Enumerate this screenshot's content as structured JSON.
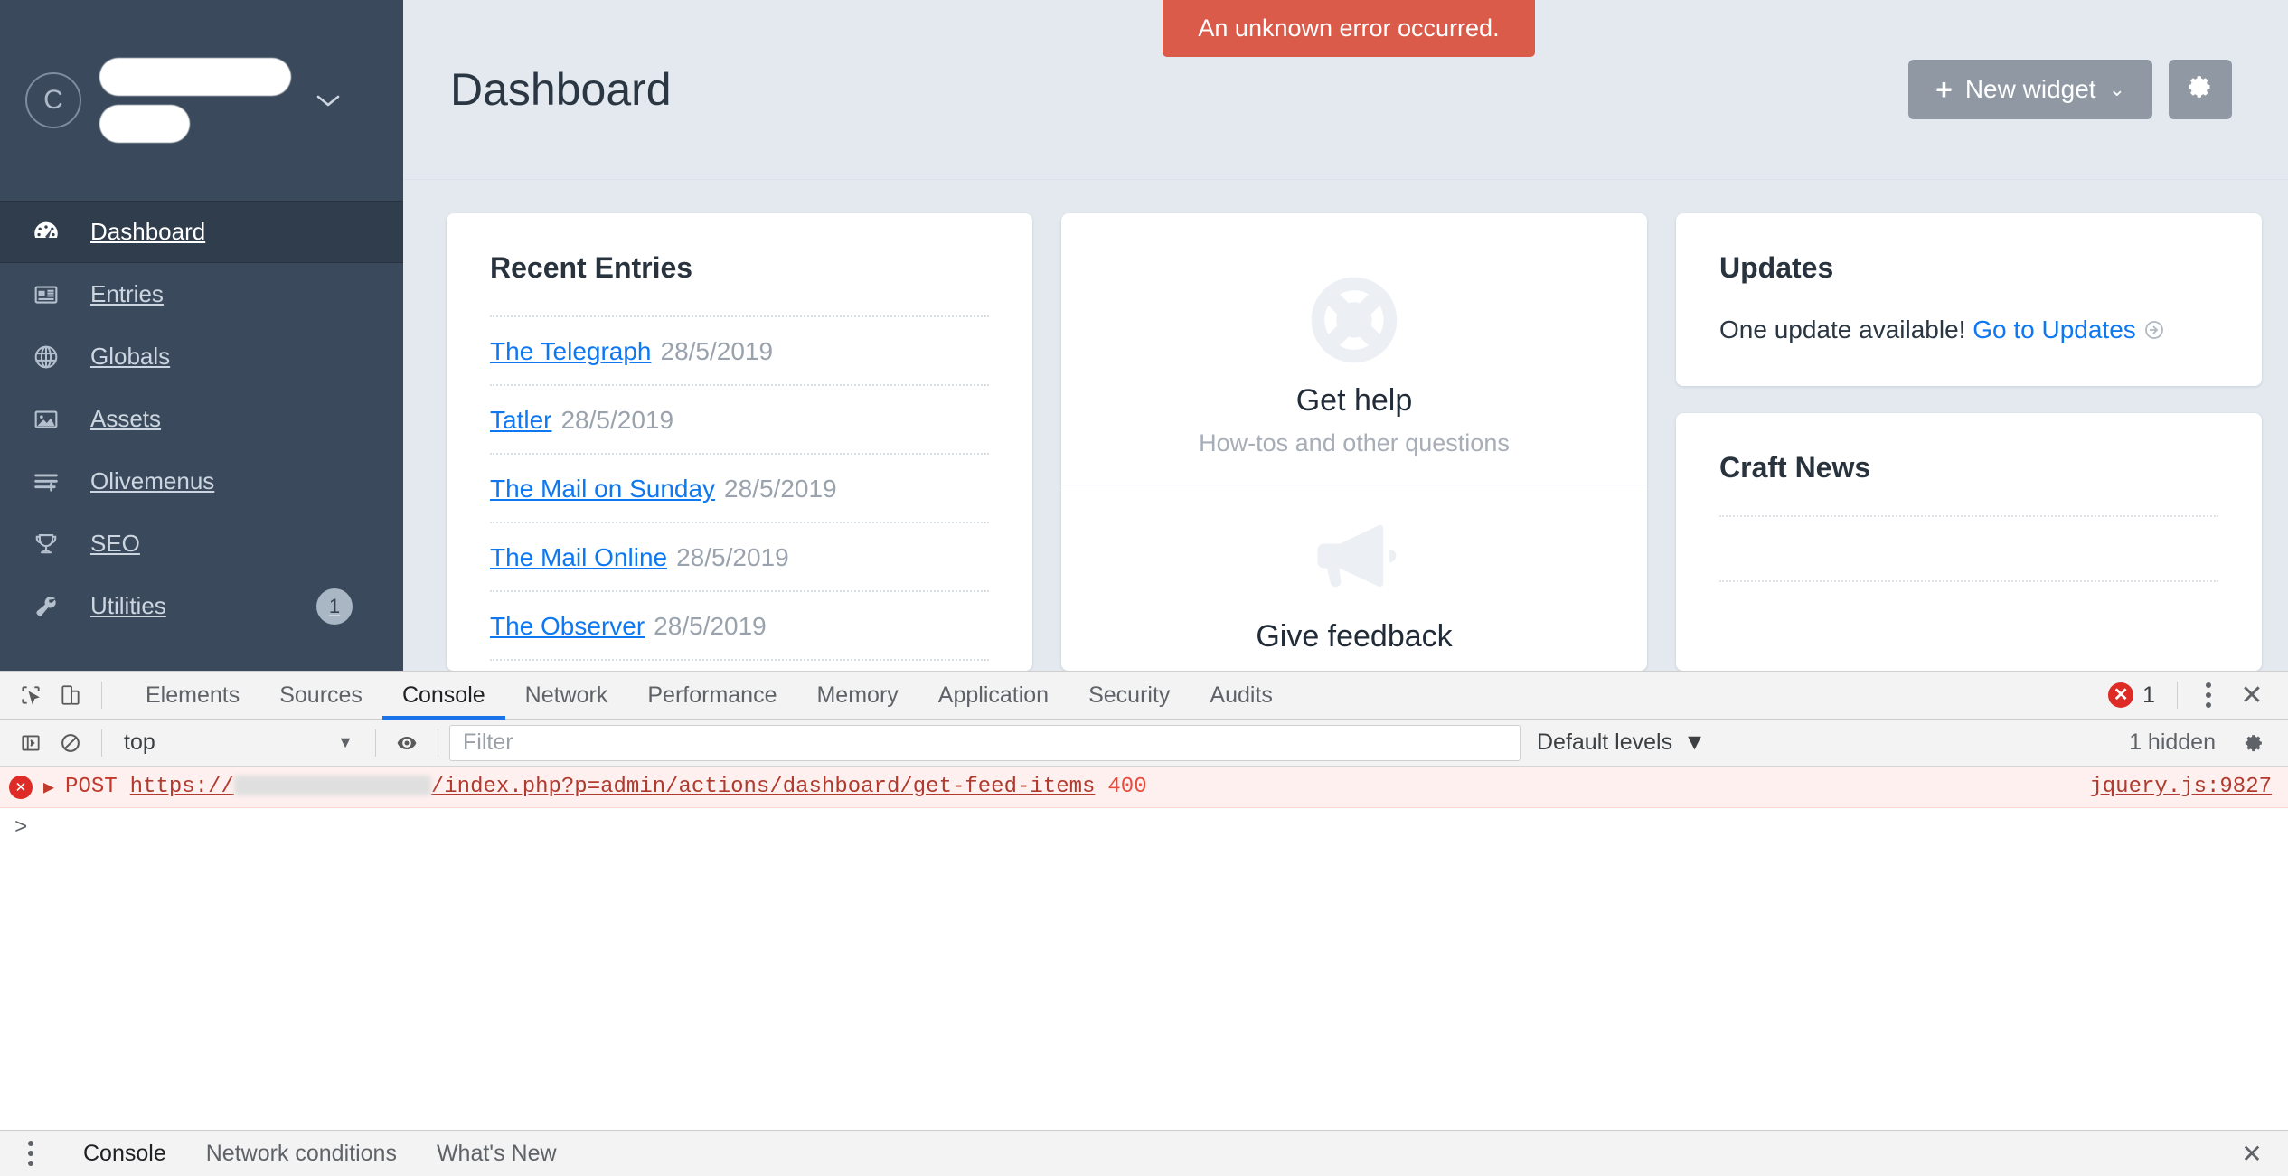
{
  "app": {
    "sidebar": {
      "logo_letter": "C",
      "site_name_redacted": true,
      "items": [
        {
          "label": "Dashboard",
          "icon": "gauge-icon",
          "active": true,
          "badge": ""
        },
        {
          "label": "Entries",
          "icon": "newspaper-icon",
          "active": false,
          "badge": ""
        },
        {
          "label": "Globals",
          "icon": "globe-icon",
          "active": false,
          "badge": ""
        },
        {
          "label": "Assets",
          "icon": "image-icon",
          "active": false,
          "badge": ""
        },
        {
          "label": "Olivemenus",
          "icon": "list-add-icon",
          "active": false,
          "badge": ""
        },
        {
          "label": "SEO",
          "icon": "trophy-icon",
          "active": false,
          "badge": ""
        },
        {
          "label": "Utilities",
          "icon": "wrench-icon",
          "active": false,
          "badge": "1"
        }
      ]
    },
    "header": {
      "title": "Dashboard",
      "new_widget_label": "New widget",
      "settings_icon": "gear-icon"
    },
    "toast": {
      "message": "An unknown error occurred.",
      "color": "#da5b49"
    },
    "widgets": {
      "recent_entries": {
        "title": "Recent Entries",
        "rows": [
          {
            "name": "The Telegraph",
            "date": "28/5/2019"
          },
          {
            "name": "Tatler",
            "date": "28/5/2019"
          },
          {
            "name": "The Mail on Sunday",
            "date": "28/5/2019"
          },
          {
            "name": "The Mail Online",
            "date": "28/5/2019"
          },
          {
            "name": "The Observer",
            "date": "28/5/2019"
          }
        ]
      },
      "help": {
        "blocks": [
          {
            "icon": "life-preserver-icon",
            "title": "Get help",
            "subtitle": "How-tos and other questions"
          },
          {
            "icon": "megaphone-icon",
            "title": "Give feedback",
            "subtitle": ""
          }
        ]
      },
      "updates": {
        "title": "Updates",
        "text": "One update available!",
        "link_label": "Go to Updates",
        "link_icon": "arrow-circle-right-icon"
      },
      "craft_news": {
        "title": "Craft News",
        "placeholder_lines": 2
      }
    },
    "accent_link_color": "#0d78f2"
  },
  "devtools": {
    "toolbar": {
      "inspect_icon": "inspect-element-icon",
      "device_icon": "device-toolbar-icon",
      "tabs": [
        {
          "label": "Elements",
          "active": false
        },
        {
          "label": "Sources",
          "active": false
        },
        {
          "label": "Console",
          "active": true
        },
        {
          "label": "Network",
          "active": false
        },
        {
          "label": "Performance",
          "active": false
        },
        {
          "label": "Memory",
          "active": false
        },
        {
          "label": "Application",
          "active": false
        },
        {
          "label": "Security",
          "active": false
        },
        {
          "label": "Audits",
          "active": false
        }
      ],
      "error_count": "1",
      "error_icon": "error-circle-icon",
      "more_icon": "kebab-menu-icon",
      "close_icon": "close-icon"
    },
    "filterbar": {
      "sidebar_toggle_icon": "console-sidebar-icon",
      "clear_icon": "clear-console-icon",
      "context": "top",
      "context_caret": "▼",
      "eye_icon": "live-expression-icon",
      "filter_placeholder": "Filter",
      "filter_value": "",
      "levels_label": "Default levels",
      "levels_caret": "▼",
      "hidden_label": "1 hidden",
      "settings_icon": "gear-icon"
    },
    "console": {
      "message": {
        "severity": "error",
        "method": "POST",
        "url_prefix": "https://",
        "url_redacted": true,
        "url_suffix": "/index.php?p=admin/actions/dashboard/get-feed-items",
        "status": "400",
        "source": "jquery.js:9827"
      },
      "prompt": ">"
    },
    "drawer": {
      "more_icon": "kebab-menu-icon",
      "tabs": [
        {
          "label": "Console",
          "active": true
        },
        {
          "label": "Network conditions",
          "active": false
        },
        {
          "label": "What's New",
          "active": false
        }
      ],
      "close_icon": "close-icon"
    }
  }
}
